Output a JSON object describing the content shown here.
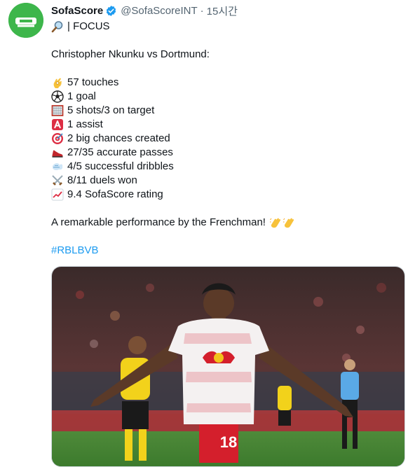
{
  "tweet": {
    "display_name": "SofaScore",
    "handle": "@SofaScoreINT",
    "separator": "·",
    "time": "15시간",
    "focus_line": "| FOCUS",
    "intro": "Christopher Nkunku vs Dortmund:",
    "stats": [
      {
        "icon": "ok-hand-icon",
        "text": "57 touches"
      },
      {
        "icon": "soccer-ball-icon",
        "text": "1 goal"
      },
      {
        "icon": "goal-net-icon",
        "text": "5 shots/3 on target"
      },
      {
        "icon": "letter-a-icon",
        "text": "1 assist"
      },
      {
        "icon": "target-icon",
        "text": "2 big chances created"
      },
      {
        "icon": "running-shoe-icon",
        "text": "27/35 accurate passes"
      },
      {
        "icon": "dash-wind-icon",
        "text": "4/5 successful dribbles"
      },
      {
        "icon": "crossed-swords-icon",
        "text": "8/11 duels won"
      },
      {
        "icon": "chart-increasing-icon",
        "text": "9.4 SofaScore rating"
      }
    ],
    "closing": "A remarkable performance by the Frenchman!",
    "hashtag": "#RBLBVB",
    "media_jersey_number": "18"
  },
  "colors": {
    "accent_link": "#1d9bf0",
    "avatar_green": "#39b54a",
    "secondary_text": "#536471"
  }
}
